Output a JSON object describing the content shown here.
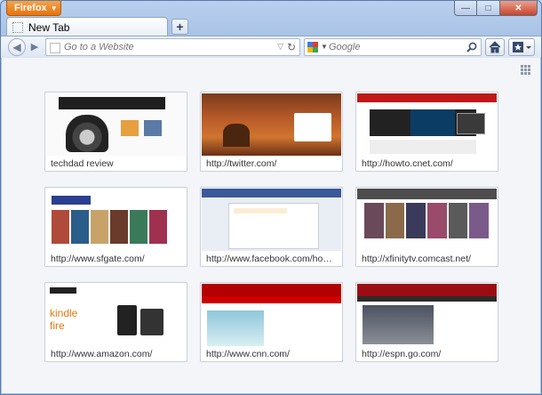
{
  "app": {
    "menu_button_label": "Firefox",
    "menu_button_arrow": "▼"
  },
  "window_controls": {
    "minimize": "—",
    "maximize": "□",
    "close": "✕"
  },
  "tabs": [
    {
      "title": "New Tab"
    }
  ],
  "new_tab_label": "+",
  "navbar": {
    "url_value": "",
    "url_placeholder": "Go to a Website",
    "search_engine": "Google",
    "search_placeholder": "Google"
  },
  "icons": {
    "back": "back-arrow-icon",
    "forward": "forward-arrow-icon",
    "reload": "reload-icon",
    "search": "magnifier-icon",
    "home": "home-icon",
    "bookmarks": "bookmarks-icon",
    "grid": "grid-toggle-icon"
  },
  "tiles": [
    {
      "label": "techdad review"
    },
    {
      "label": "http://twitter.com/"
    },
    {
      "label": "http://howto.cnet.com/"
    },
    {
      "label": "http://www.sfgate.com/"
    },
    {
      "label": "http://www.facebook.com/home.p..."
    },
    {
      "label": "http://xfinitytv.comcast.net/"
    },
    {
      "label": "http://www.amazon.com/"
    },
    {
      "label": "http://www.cnn.com/"
    },
    {
      "label": "http://espn.go.com/"
    }
  ],
  "thumb_text": {
    "amazon_kindle": "kindle fire"
  }
}
